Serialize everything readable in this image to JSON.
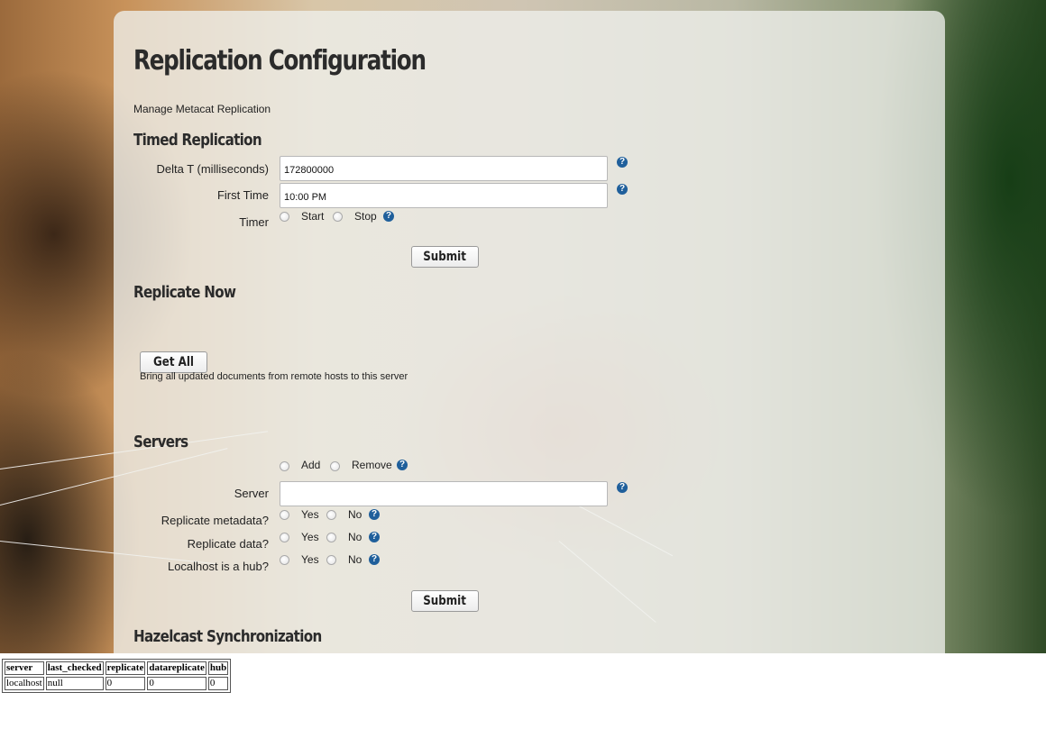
{
  "page": {
    "title": "Replication Configuration",
    "subtitle": "Manage Metacat Replication"
  },
  "timed_replication": {
    "heading": "Timed Replication",
    "delta_label": "Delta T (milliseconds)",
    "delta_value": "172800000",
    "first_time_label": "First Time",
    "first_time_value": "10:00 PM",
    "timer_label": "Timer",
    "timer_start": "Start",
    "timer_stop": "Stop",
    "submit": "Submit"
  },
  "replicate_now": {
    "heading": "Replicate Now",
    "get_all": "Get All",
    "description": "Bring all updated documents from remote hosts to this server"
  },
  "servers": {
    "heading": "Servers",
    "add": "Add",
    "remove": "Remove",
    "server_label": "Server",
    "server_value": "",
    "metadata_label": "Replicate metadata?",
    "data_label": "Replicate data?",
    "hub_label": "Localhost is a hub?",
    "yes": "Yes",
    "no": "No",
    "submit": "Submit"
  },
  "hazelcast": {
    "heading": "Hazelcast Synchronization"
  },
  "help_icon": "?",
  "table": {
    "headers": [
      "server",
      "last_checked",
      "replicate",
      "datareplicate",
      "hub"
    ],
    "rows": [
      [
        "localhost",
        "null",
        "0",
        "0",
        "0"
      ]
    ]
  },
  "colors": {
    "help_icon": "#1f5f9b",
    "panel": "#eef0ec"
  }
}
